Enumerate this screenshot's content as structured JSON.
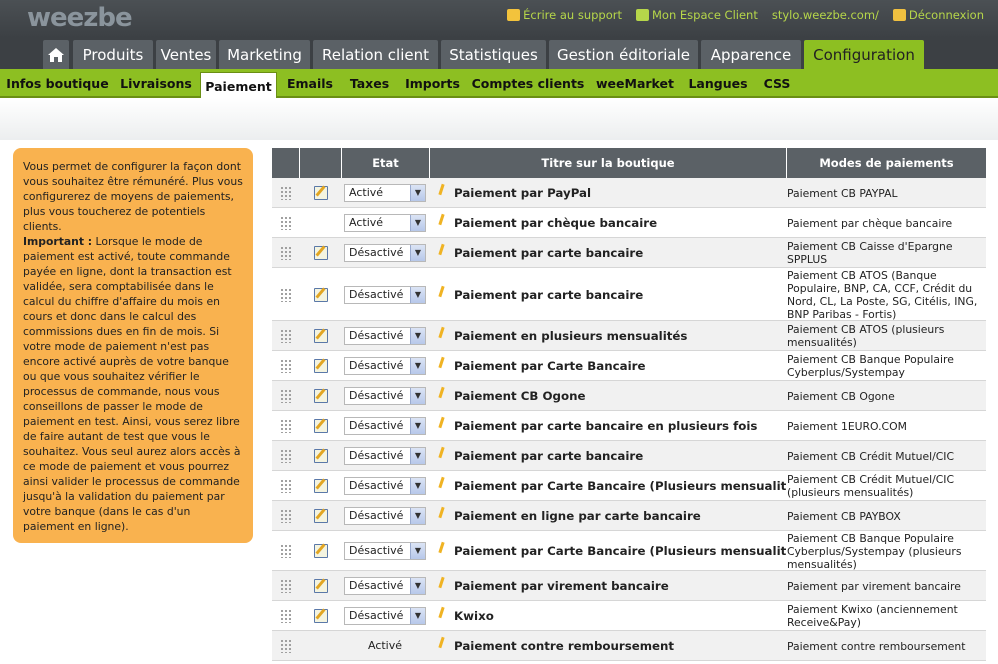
{
  "brand": {
    "logo": "weezbe"
  },
  "top_links": [
    {
      "label": "Écrire au support",
      "icon": "edit-icon",
      "color": "#f3c33c"
    },
    {
      "label": "Mon Espace Client",
      "icon": "bulb-icon",
      "color": "#b6d64a"
    },
    {
      "label": "stylo.weezbe.com/",
      "icon": "",
      "color": ""
    },
    {
      "label": "Déconnexion",
      "icon": "lock-icon",
      "color": "#f0c040"
    }
  ],
  "main_nav": {
    "home_icon": "home-icon",
    "items": [
      "Produits",
      "Ventes",
      "Marketing",
      "Relation client",
      "Statistiques",
      "Gestion éditoriale",
      "Apparence",
      "Configuration"
    ],
    "active": "Configuration"
  },
  "sub_nav": {
    "items": [
      "Infos boutique",
      "Livraisons",
      "Paiement",
      "Emails",
      "Taxes",
      "Imports",
      "Comptes clients",
      "weeMarket",
      "Langues",
      "CSS"
    ],
    "active": "Paiement"
  },
  "help": {
    "intro": "Vous permet de configurer la façon dont vous souhaitez être rémunéré. Plus vous configurerez de moyens de paiements, plus vous toucherez de potentiels clients.",
    "important_label": "Important :",
    "important_text": " Lorsque le mode de paiement est activé, toute commande payée en ligne, dont la transaction est validée, sera comptabilisée dans le calcul du chiffre d'affaire du mois en cours et donc dans le calcul des commissions dues en fin de mois. Si votre mode de paiement n'est pas encore activé auprès de votre banque ou que vous souhaitez vérifier le processus de commande, nous vous conseillons de passer le mode de paiement en test. Ainsi, vous serez libre de faire autant de test que vous le souhaitez. Vous seul aurez alors accès à ce mode de paiement et vous pourrez ainsi valider le processus de commande jusqu'à la validation du paiement par votre banque (dans le cas d'un paiement en ligne)."
  },
  "table": {
    "headers": [
      "",
      "",
      "Etat",
      "Titre sur la boutique",
      "Modes de paiements"
    ],
    "rows": [
      {
        "edit": true,
        "state": "Activé",
        "select": true,
        "title": "Paiement par PayPal",
        "mode": "Paiement CB PAYPAL"
      },
      {
        "edit": false,
        "state": "Activé",
        "select": true,
        "title": "Paiement par chèque bancaire",
        "mode": "Paiement par chèque bancaire"
      },
      {
        "edit": true,
        "state": "Désactivé",
        "select": true,
        "title": "Paiement par carte bancaire",
        "mode": "Paiement CB Caisse d'Epargne SPPLUS"
      },
      {
        "edit": true,
        "state": "Désactivé",
        "select": true,
        "title": "Paiement par carte bancaire",
        "mode": "Paiement CB ATOS (Banque Populaire, BNP, CA, CCF, Crédit du Nord, CL, La Poste, SG, Citélis, ING, BNP Paribas - Fortis)"
      },
      {
        "edit": true,
        "state": "Désactivé",
        "select": true,
        "title": "Paiement en plusieurs mensualités",
        "mode": "Paiement CB ATOS (plusieurs mensualités)"
      },
      {
        "edit": true,
        "state": "Désactivé",
        "select": true,
        "title": "Paiement par Carte Bancaire",
        "mode": "Paiement CB Banque Populaire Cyberplus/Systempay"
      },
      {
        "edit": true,
        "state": "Désactivé",
        "select": true,
        "title": "Paiement CB Ogone",
        "mode": "Paiement CB Ogone"
      },
      {
        "edit": true,
        "state": "Désactivé",
        "select": true,
        "title": "Paiement par carte bancaire en plusieurs fois",
        "mode": "Paiement 1EURO.COM"
      },
      {
        "edit": true,
        "state": "Désactivé",
        "select": true,
        "title": "Paiement par carte bancaire",
        "mode": "Paiement CB Crédit Mutuel/CIC"
      },
      {
        "edit": true,
        "state": "Désactivé",
        "select": true,
        "title": "Paiement par Carte Bancaire (Plusieurs mensualités)",
        "mode": "Paiement CB Crédit Mutuel/CIC (plusieurs mensualités)"
      },
      {
        "edit": true,
        "state": "Désactivé",
        "select": true,
        "title": "Paiement en ligne par carte bancaire",
        "mode": "Paiement CB PAYBOX"
      },
      {
        "edit": true,
        "state": "Désactivé",
        "select": true,
        "title": "Paiement par Carte Bancaire (Plusieurs mensualités)",
        "mode": "Paiement CB Banque Populaire Cyberplus/Systempay (plusieurs mensualités)"
      },
      {
        "edit": true,
        "state": "Désactivé",
        "select": true,
        "title": "Paiement par virement bancaire",
        "mode": "Paiement par virement bancaire"
      },
      {
        "edit": true,
        "state": "Désactivé",
        "select": true,
        "title": "Kwixo",
        "mode": "Paiement Kwixo (anciennement Receive&Pay)"
      },
      {
        "edit": false,
        "state": "Activé",
        "select": false,
        "title": "Paiement contre remboursement",
        "mode": "Paiement contre remboursement"
      }
    ]
  }
}
